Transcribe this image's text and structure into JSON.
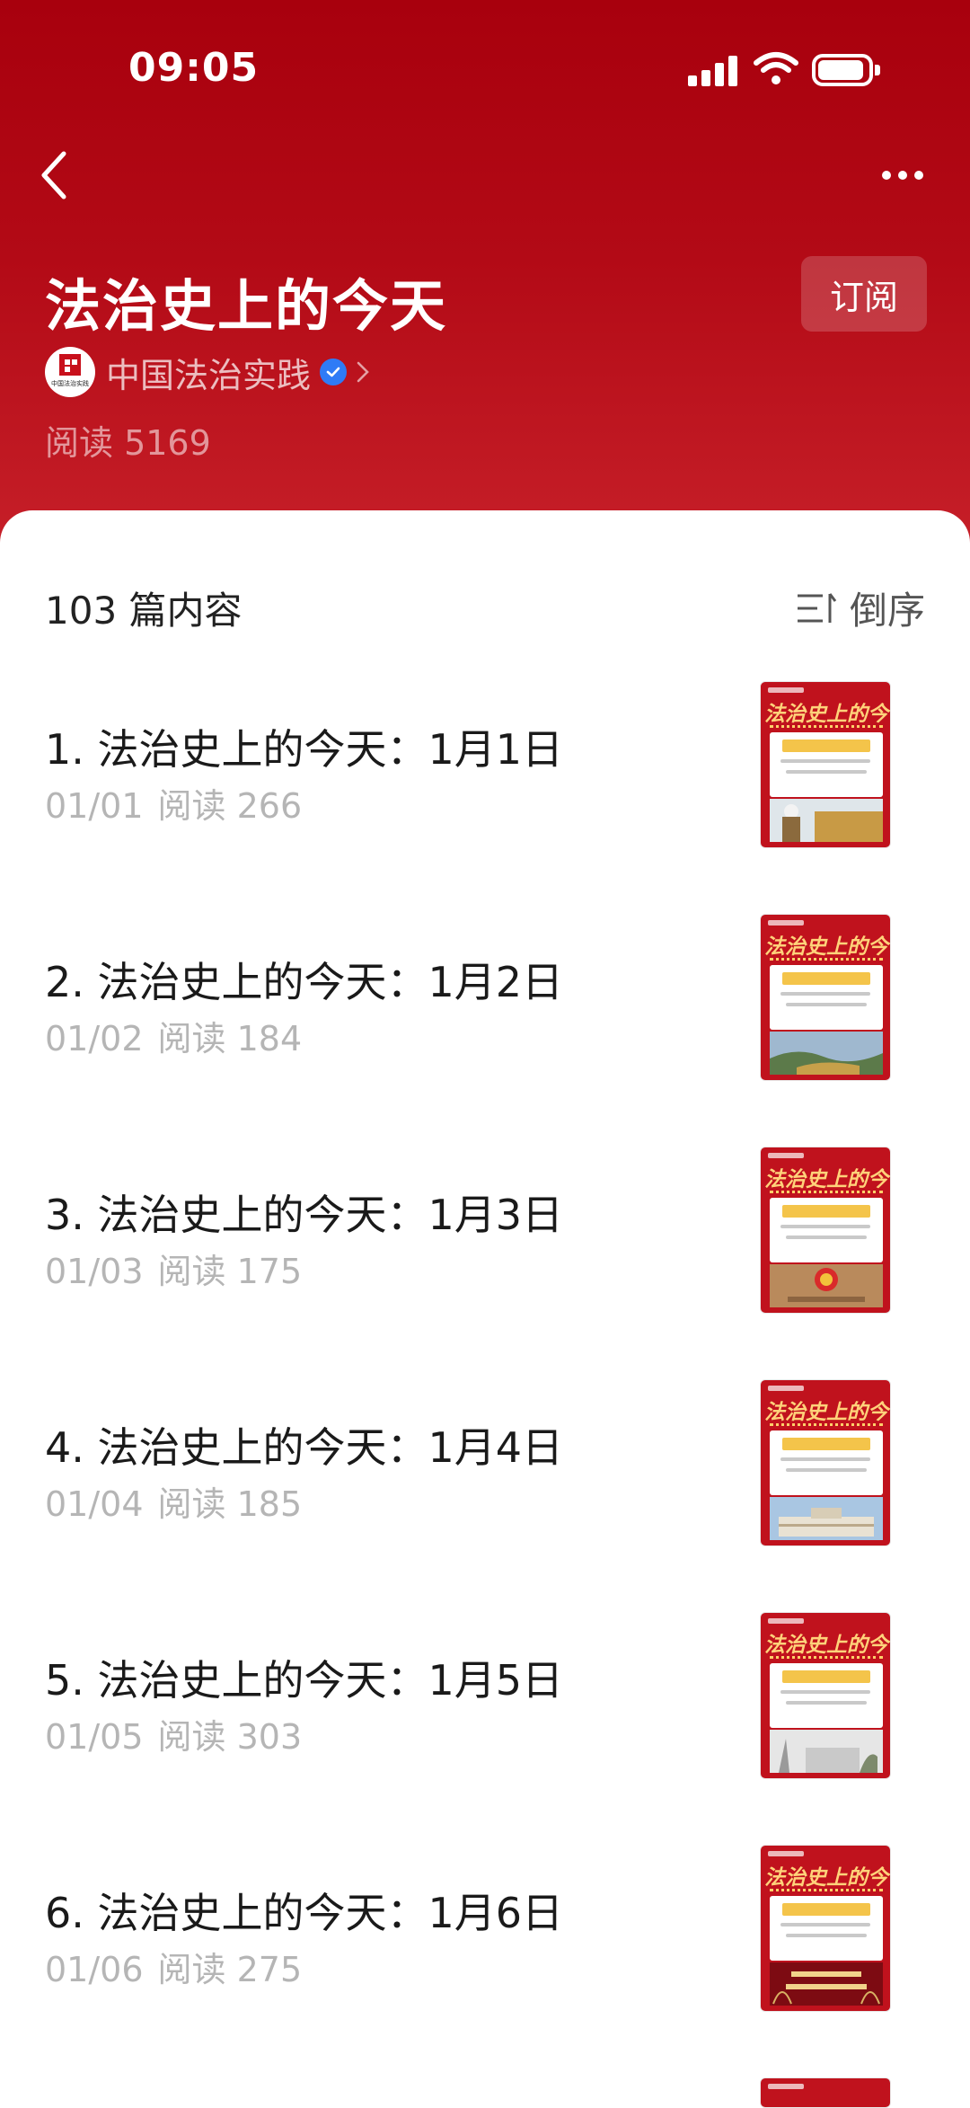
{
  "status": {
    "time": "09:05"
  },
  "header": {
    "title": "法治史上的今天",
    "subscribe_label": "订阅",
    "author": "中国法治实践",
    "avatar_text": "中国法治实践",
    "read_count": "阅读 5169"
  },
  "list": {
    "count_label": "103 篇内容",
    "sort_label": "倒序",
    "items": [
      {
        "title": "1. 法治史上的今天：1月1日",
        "date": "01/01",
        "reads": "阅读 266"
      },
      {
        "title": "2. 法治史上的今天：1月2日",
        "date": "01/02",
        "reads": "阅读 184"
      },
      {
        "title": "3. 法治史上的今天：1月3日",
        "date": "01/03",
        "reads": "阅读 175"
      },
      {
        "title": "4. 法治史上的今天：1月4日",
        "date": "01/04",
        "reads": "阅读 185"
      },
      {
        "title": "5. 法治史上的今天：1月5日",
        "date": "01/05",
        "reads": "阅读 303"
      },
      {
        "title": "6. 法治史上的今天：1月6日",
        "date": "01/06",
        "reads": "阅读 275"
      }
    ],
    "thumb_title": "法治史上的今天"
  },
  "colors": {
    "brand_red": "#c0121d",
    "accent_blue": "#2f7bf6"
  }
}
